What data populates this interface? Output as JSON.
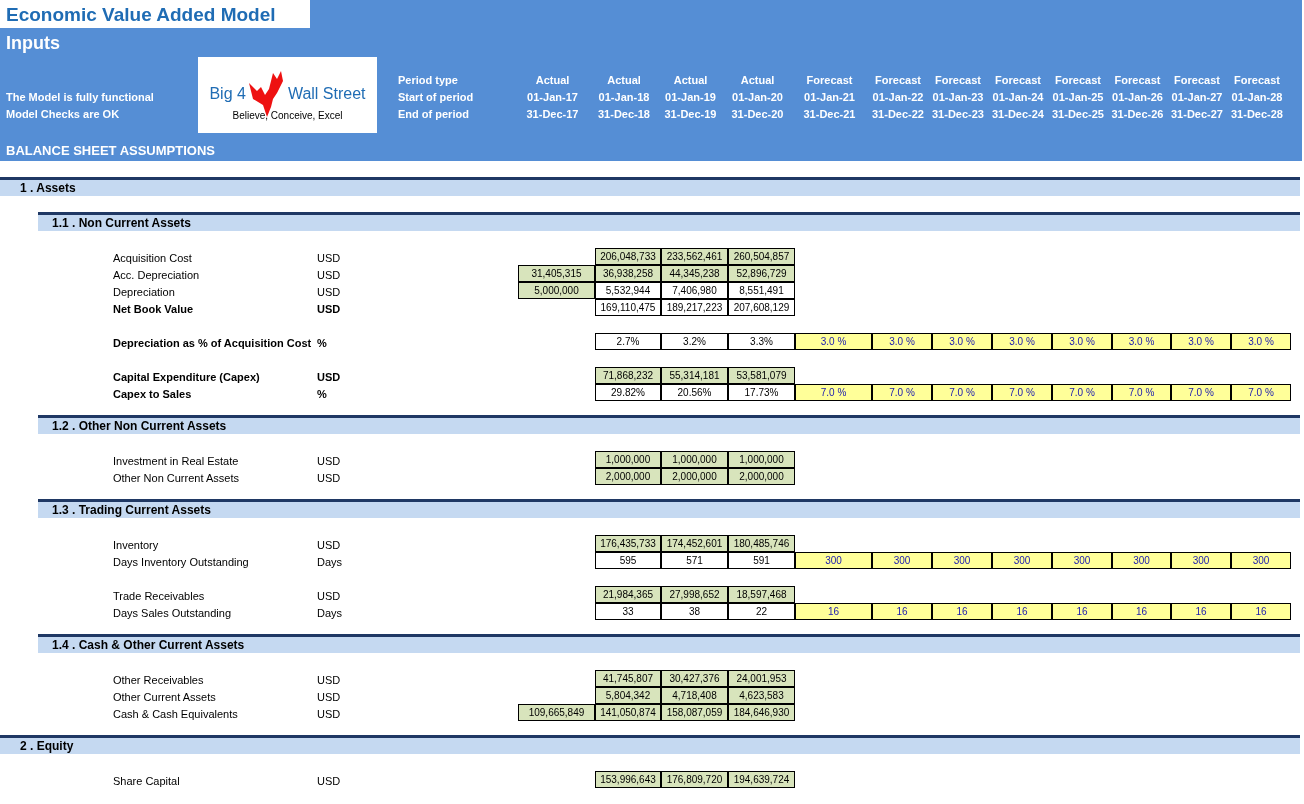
{
  "header": {
    "title": "Economic Value Added Model",
    "subtitle": "Inputs",
    "status": [
      "The Model is fully functional",
      "Model Checks are OK"
    ],
    "logo": {
      "left": "Big 4",
      "right": "Wall Street",
      "tagline": "Believe, Conceive, Excel"
    },
    "period_labels": [
      "Period type",
      "Start of period",
      "End of period"
    ],
    "periods": [
      {
        "type": "Actual",
        "start": "01-Jan-17",
        "end": "31-Dec-17"
      },
      {
        "type": "Actual",
        "start": "01-Jan-18",
        "end": "31-Dec-18"
      },
      {
        "type": "Actual",
        "start": "01-Jan-19",
        "end": "31-Dec-19"
      },
      {
        "type": "Actual",
        "start": "01-Jan-20",
        "end": "31-Dec-20"
      },
      {
        "type": "Forecast",
        "start": "01-Jan-21",
        "end": "31-Dec-21"
      },
      {
        "type": "Forecast",
        "start": "01-Jan-22",
        "end": "31-Dec-22"
      },
      {
        "type": "Forecast",
        "start": "01-Jan-23",
        "end": "31-Dec-23"
      },
      {
        "type": "Forecast",
        "start": "01-Jan-24",
        "end": "31-Dec-24"
      },
      {
        "type": "Forecast",
        "start": "01-Jan-25",
        "end": "31-Dec-25"
      },
      {
        "type": "Forecast",
        "start": "01-Jan-26",
        "end": "31-Dec-26"
      },
      {
        "type": "Forecast",
        "start": "01-Jan-27",
        "end": "31-Dec-27"
      },
      {
        "type": "Forecast",
        "start": "01-Jan-28",
        "end": "31-Dec-28"
      }
    ],
    "section_title": "BALANCE SHEET ASSUMPTIONS"
  },
  "sections": [
    {
      "title": "1 . Assets",
      "children": [
        {
          "title": "1.1 . Non Current Assets",
          "blocks": [
            [
              {
                "label": "Acquisition Cost",
                "unit": "USD",
                "bold": false,
                "cells": [
                  null,
                  {
                    "kind": "input",
                    "value": "206,048,733"
                  },
                  {
                    "kind": "input",
                    "value": "233,562,461"
                  },
                  {
                    "kind": "input",
                    "value": "260,504,857"
                  }
                ]
              },
              {
                "label": "Acc. Depreciation",
                "unit": "USD",
                "bold": false,
                "cells": [
                  {
                    "kind": "input",
                    "value": "31,405,315"
                  },
                  {
                    "kind": "input",
                    "value": "36,938,258"
                  },
                  {
                    "kind": "input",
                    "value": "44,345,238"
                  },
                  {
                    "kind": "input",
                    "value": "52,896,729"
                  }
                ]
              },
              {
                "label": "Depreciation",
                "unit": "USD",
                "bold": false,
                "cells": [
                  {
                    "kind": "input",
                    "value": "5,000,000"
                  },
                  {
                    "kind": "calc",
                    "value": "5,532,944"
                  },
                  {
                    "kind": "calc",
                    "value": "7,406,980"
                  },
                  {
                    "kind": "calc",
                    "value": "8,551,491"
                  }
                ]
              },
              {
                "label": "Net Book Value",
                "unit": "USD",
                "bold": true,
                "cells": [
                  null,
                  {
                    "kind": "calc",
                    "value": "169,110,475"
                  },
                  {
                    "kind": "calc",
                    "value": "189,217,223"
                  },
                  {
                    "kind": "calc",
                    "value": "207,608,129"
                  }
                ]
              }
            ],
            [
              {
                "label": "Depreciation as % of Acquisition Cost",
                "unit": "%",
                "bold": true,
                "cells": [
                  null,
                  {
                    "kind": "calc",
                    "value": "2.7%"
                  },
                  {
                    "kind": "calc",
                    "value": "3.2%"
                  },
                  {
                    "kind": "calc",
                    "value": "3.3%"
                  },
                  {
                    "kind": "assumption",
                    "value": "3.0 %"
                  },
                  {
                    "kind": "assumption",
                    "value": "3.0 %"
                  },
                  {
                    "kind": "assumption",
                    "value": "3.0 %"
                  },
                  {
                    "kind": "assumption",
                    "value": "3.0 %"
                  },
                  {
                    "kind": "assumption",
                    "value": "3.0 %"
                  },
                  {
                    "kind": "assumption",
                    "value": "3.0 %"
                  },
                  {
                    "kind": "assumption",
                    "value": "3.0 %"
                  },
                  {
                    "kind": "assumption",
                    "value": "3.0 %"
                  }
                ]
              }
            ],
            [
              {
                "label": "Capital Expenditure (Capex)",
                "unit": "USD",
                "bold": true,
                "cells": [
                  null,
                  {
                    "kind": "input",
                    "value": "71,868,232"
                  },
                  {
                    "kind": "input",
                    "value": "55,314,181"
                  },
                  {
                    "kind": "input",
                    "value": "53,581,079"
                  }
                ]
              },
              {
                "label": "Capex to Sales",
                "unit": "%",
                "bold": true,
                "cells": [
                  null,
                  {
                    "kind": "calc",
                    "value": "29.82%"
                  },
                  {
                    "kind": "calc",
                    "value": "20.56%"
                  },
                  {
                    "kind": "calc",
                    "value": "17.73%"
                  },
                  {
                    "kind": "assumption",
                    "value": "7.0 %"
                  },
                  {
                    "kind": "assumption",
                    "value": "7.0 %"
                  },
                  {
                    "kind": "assumption",
                    "value": "7.0 %"
                  },
                  {
                    "kind": "assumption",
                    "value": "7.0 %"
                  },
                  {
                    "kind": "assumption",
                    "value": "7.0 %"
                  },
                  {
                    "kind": "assumption",
                    "value": "7.0 %"
                  },
                  {
                    "kind": "assumption",
                    "value": "7.0 %"
                  },
                  {
                    "kind": "assumption",
                    "value": "7.0 %"
                  }
                ]
              }
            ]
          ]
        },
        {
          "title": "1.2 . Other Non Current Assets",
          "blocks": [
            [
              {
                "label": "Investment in Real Estate",
                "unit": "USD",
                "bold": false,
                "cells": [
                  null,
                  {
                    "kind": "input",
                    "value": "1,000,000"
                  },
                  {
                    "kind": "input",
                    "value": "1,000,000"
                  },
                  {
                    "kind": "input",
                    "value": "1,000,000"
                  }
                ]
              },
              {
                "label": "Other Non Current Assets",
                "unit": "USD",
                "bold": false,
                "cells": [
                  null,
                  {
                    "kind": "input",
                    "value": "2,000,000"
                  },
                  {
                    "kind": "input",
                    "value": "2,000,000"
                  },
                  {
                    "kind": "input",
                    "value": "2,000,000"
                  }
                ]
              }
            ]
          ]
        },
        {
          "title": "1.3 . Trading Current Assets",
          "blocks": [
            [
              {
                "label": "Inventory",
                "unit": "USD",
                "bold": false,
                "cells": [
                  null,
                  {
                    "kind": "input",
                    "value": "176,435,733"
                  },
                  {
                    "kind": "input",
                    "value": "174,452,601"
                  },
                  {
                    "kind": "input",
                    "value": "180,485,746"
                  }
                ]
              },
              {
                "label": "Days Inventory Outstanding",
                "unit": "Days",
                "bold": false,
                "cells": [
                  null,
                  {
                    "kind": "calc",
                    "value": "595"
                  },
                  {
                    "kind": "calc",
                    "value": "571"
                  },
                  {
                    "kind": "calc",
                    "value": "591"
                  },
                  {
                    "kind": "assumption",
                    "value": "300"
                  },
                  {
                    "kind": "assumption",
                    "value": "300"
                  },
                  {
                    "kind": "assumption",
                    "value": "300"
                  },
                  {
                    "kind": "assumption",
                    "value": "300"
                  },
                  {
                    "kind": "assumption",
                    "value": "300"
                  },
                  {
                    "kind": "assumption",
                    "value": "300"
                  },
                  {
                    "kind": "assumption",
                    "value": "300"
                  },
                  {
                    "kind": "assumption",
                    "value": "300"
                  }
                ]
              }
            ],
            [
              {
                "label": "Trade Receivables",
                "unit": "USD",
                "bold": false,
                "cells": [
                  null,
                  {
                    "kind": "input",
                    "value": "21,984,365"
                  },
                  {
                    "kind": "input",
                    "value": "27,998,652"
                  },
                  {
                    "kind": "input",
                    "value": "18,597,468"
                  }
                ]
              },
              {
                "label": "Days Sales Outstanding",
                "unit": "Days",
                "bold": false,
                "cells": [
                  null,
                  {
                    "kind": "calc",
                    "value": "33"
                  },
                  {
                    "kind": "calc",
                    "value": "38"
                  },
                  {
                    "kind": "calc",
                    "value": "22"
                  },
                  {
                    "kind": "assumption",
                    "value": "16"
                  },
                  {
                    "kind": "assumption",
                    "value": "16"
                  },
                  {
                    "kind": "assumption",
                    "value": "16"
                  },
                  {
                    "kind": "assumption",
                    "value": "16"
                  },
                  {
                    "kind": "assumption",
                    "value": "16"
                  },
                  {
                    "kind": "assumption",
                    "value": "16"
                  },
                  {
                    "kind": "assumption",
                    "value": "16"
                  },
                  {
                    "kind": "assumption",
                    "value": "16"
                  }
                ]
              }
            ]
          ]
        },
        {
          "title": "1.4 . Cash & Other Current Assets",
          "blocks": [
            [
              {
                "label": "Other Receivables",
                "unit": "USD",
                "bold": false,
                "cells": [
                  null,
                  {
                    "kind": "input",
                    "value": "41,745,807"
                  },
                  {
                    "kind": "input",
                    "value": "30,427,376"
                  },
                  {
                    "kind": "input",
                    "value": "24,001,953"
                  }
                ]
              },
              {
                "label": "Other Current Assets",
                "unit": "USD",
                "bold": false,
                "cells": [
                  null,
                  {
                    "kind": "input",
                    "value": "5,804,342"
                  },
                  {
                    "kind": "input",
                    "value": "4,718,408"
                  },
                  {
                    "kind": "input",
                    "value": "4,623,583"
                  }
                ]
              },
              {
                "label": "Cash & Cash Equivalents",
                "unit": "USD",
                "bold": false,
                "cells": [
                  {
                    "kind": "input",
                    "value": "109,665,849"
                  },
                  {
                    "kind": "input",
                    "value": "141,050,874"
                  },
                  {
                    "kind": "input",
                    "value": "158,087,059"
                  },
                  {
                    "kind": "input",
                    "value": "184,646,930"
                  }
                ]
              }
            ]
          ]
        }
      ]
    },
    {
      "title": "2 . Equity",
      "blocks": [
        [
          {
            "label": "Share Capital",
            "unit": "USD",
            "bold": false,
            "cells": [
              null,
              {
                "kind": "input",
                "value": "153,996,643"
              },
              {
                "kind": "input",
                "value": "176,809,720"
              },
              {
                "kind": "input",
                "value": "194,639,724"
              }
            ]
          }
        ]
      ]
    }
  ]
}
